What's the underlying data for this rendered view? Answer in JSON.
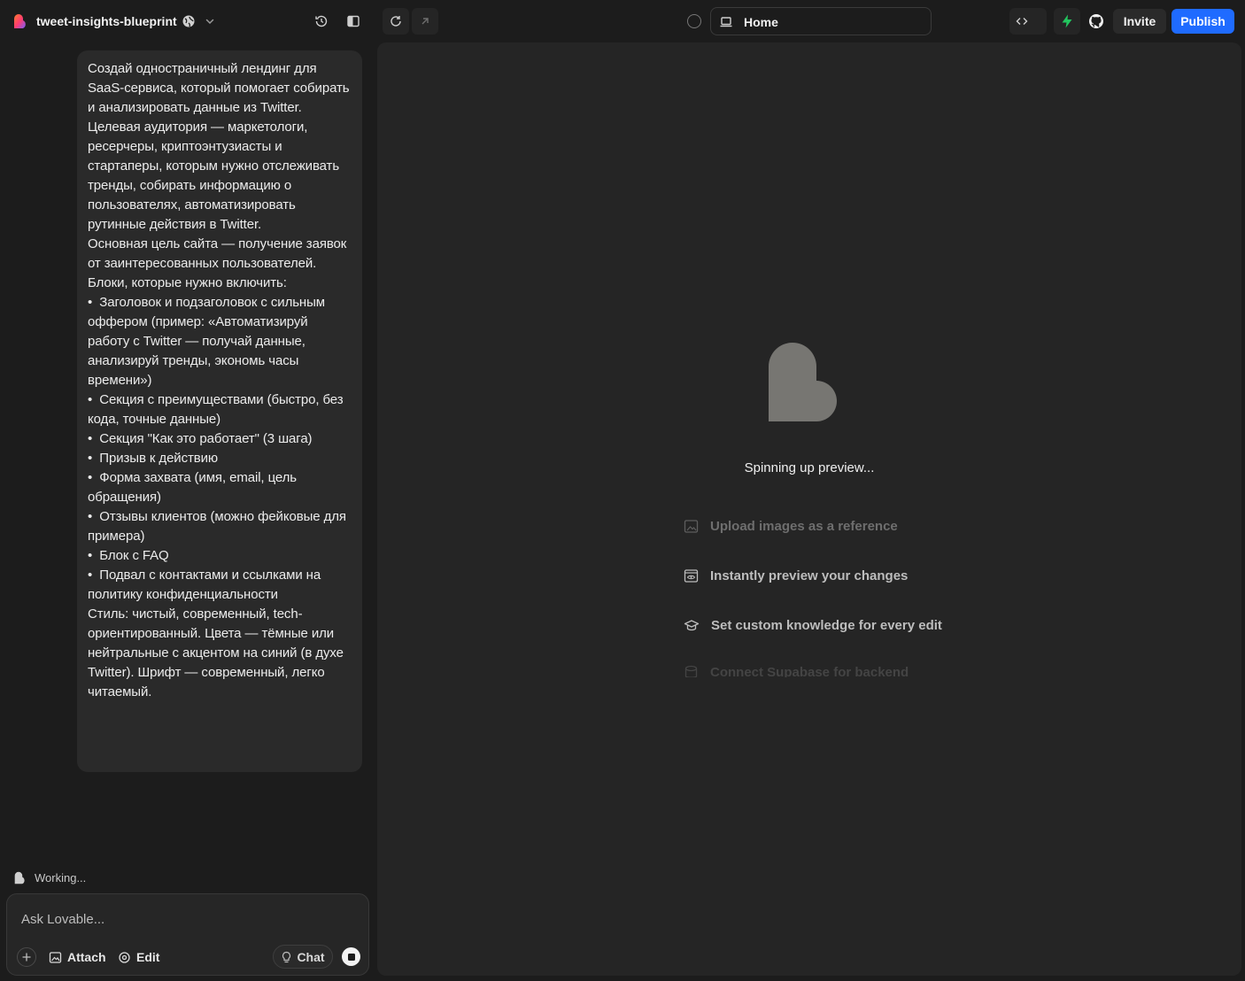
{
  "header": {
    "project_name": "tweet-insights-blueprint",
    "address_route": "Home",
    "invite_label": "Invite",
    "publish_label": "Publish"
  },
  "chat": {
    "user_message": "Создай одностраничный лендинг для SaaS-сервиса, который помогает собирать и анализировать данные из Twitter.\nЦелевая аудитория — маркетологи, ресерчеры, криптоэнтузиасты и стартаперы, которым нужно отслеживать тренды, собирать информацию о пользователях, автоматизировать рутинные действия в Twitter.\nОсновная цель сайта — получение заявок от заинтересованных пользователей.\nБлоки, которые нужно включить:\n•  Заголовок и подзаголовок с сильным оффером (пример: «Автоматизируй работу с Twitter — получай данные, анализируй тренды, экономь часы времени»)\n•  Секция с преимуществами (быстро, без кода, точные данные)\n•  Секция \"Как это работает\" (3 шага)\n•  Призыв к действию\n•  Форма захвата (имя, email, цель обращения)\n•  Отзывы клиентов (можно фейковые для примера)\n•  Блок с FAQ\n•  Подвал с контактами и ссылками на политику конфиденциальности\nСтиль: чистый, современный, tech-ориентированный. Цвета — тёмные или нейтральные с акцентом на синий (в духе Twitter). Шрифт — современный, легко читаемый.",
    "status_text": "Working..."
  },
  "composer": {
    "placeholder": "Ask Lovable...",
    "attach_label": "Attach",
    "edit_label": "Edit",
    "chat_label": "Chat"
  },
  "preview": {
    "loading_text": "Spinning up preview...",
    "tips": [
      "Upload images as a reference",
      "Instantly preview your changes",
      "Set custom knowledge for every edit",
      "Connect Supabase for backend"
    ]
  },
  "colors": {
    "background": "#1c1c1c",
    "panel": "#252525",
    "bubble": "#2a2a2a",
    "publish": "#1f6bff",
    "bolt": "#22c55e",
    "heart": "#777672"
  },
  "icons": [
    "lovable-logo-icon",
    "globe-icon",
    "chevron-down-icon",
    "history-icon",
    "sidebar-toggle-icon",
    "refresh-icon",
    "arrow-up-right-icon",
    "laptop-icon",
    "code-icon",
    "bolt-icon",
    "github-icon",
    "plus-icon",
    "image-icon",
    "edit-target-icon",
    "lightbulb-icon",
    "stop-icon",
    "eye-preview-icon",
    "graduation-cap-icon",
    "database-icon"
  ]
}
